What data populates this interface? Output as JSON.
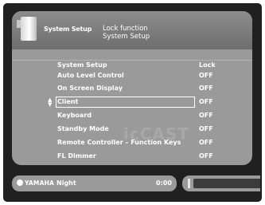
{
  "header": {
    "app_name": "System Setup",
    "title_line1": "Lock function",
    "title_line2": "System Setup",
    "icon": "amplifier-icon"
  },
  "menu": {
    "header_label": "System Setup",
    "header_value": "Lock",
    "items": [
      {
        "label": "Auto Level Control",
        "value": "OFF"
      },
      {
        "label": "On Screen Display",
        "value": "OFF"
      },
      {
        "label": "Client",
        "value": "OFF",
        "selected": true
      },
      {
        "label": "Keyboard",
        "value": "OFF"
      },
      {
        "label": "Standby Mode",
        "value": "OFF"
      },
      {
        "label": "Remote Controller – Function Keys",
        "value": "OFF"
      },
      {
        "label": "FL Dimmer",
        "value": "OFF"
      }
    ]
  },
  "watermark": "icCAST",
  "status": {
    "brand": "YAMAHA",
    "sound_mode": "Night",
    "time": "0:00"
  }
}
